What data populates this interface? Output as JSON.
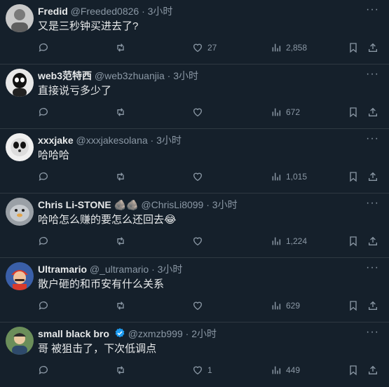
{
  "more_label": "···",
  "tweets": [
    {
      "name": "Fredid",
      "handle": "@Freeded0826",
      "separator": "·",
      "time": "3小时",
      "text": "又是三秒钟买进去了?",
      "likes": "27",
      "views": "2,858",
      "avatar_color": "#c9c9c9"
    },
    {
      "name": "web3范特西",
      "handle": "@web3zhuanjia",
      "separator": "·",
      "time": "3小时",
      "text": "直接说亏多少了",
      "likes": "",
      "views": "672",
      "avatar_color": "#e8e8e8"
    },
    {
      "name": "xxxjake",
      "handle": "@xxxjakesolana",
      "separator": "·",
      "time": "3小时",
      "text": "哈哈哈",
      "likes": "",
      "views": "1,015",
      "avatar_color": "#f0f0f0"
    },
    {
      "name": "Chris Li-STONE",
      "name_suffix": "🪨🪨",
      "handle": "@ChrisLi8099",
      "separator": "·",
      "time": "3小时",
      "text": "哈哈怎么赚的要怎么还回去😂",
      "likes": "",
      "views": "1,224",
      "avatar_color": "#9aa0a6"
    },
    {
      "name": "Ultramario",
      "handle": "@_ultramario",
      "separator": "·",
      "time": "3小时",
      "text": "散户砸的和币安有什么关系",
      "likes": "",
      "views": "629",
      "avatar_color": "#d93a2b"
    },
    {
      "name": "small black bro",
      "handle": "@zxmzb999",
      "separator": "·",
      "time": "2小时",
      "text": "哥 被狙击了，下次低调点",
      "likes": "1",
      "views": "449",
      "avatar_color": "#6b8e5a",
      "verified": true
    }
  ]
}
